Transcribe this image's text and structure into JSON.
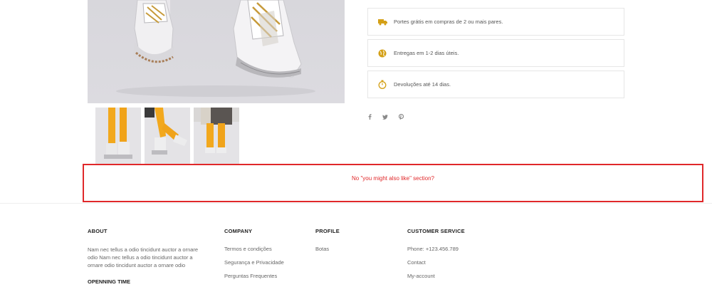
{
  "features": [
    {
      "icon": "truck-icon",
      "text": "Portes grátis em compras de 2 ou mais pares."
    },
    {
      "icon": "globe-icon",
      "text": "Entregas em 1-2 dias úteis."
    },
    {
      "icon": "stopwatch-icon",
      "text": "Devoluções até 14 dias."
    }
  ],
  "social": [
    "facebook-icon",
    "twitter-icon",
    "pinterest-icon"
  ],
  "annotation": {
    "text": "No \"you might also like\" section?",
    "color": "#e0282a"
  },
  "footer": {
    "about": {
      "heading": "ABOUT",
      "text": "Nam nec tellus a odio tincidunt auctor a ornare odio Nam nec tellus a odio tincidunt auctor a ornare odio tincidunt auctor a ornare odio"
    },
    "opening_heading": "OPENNING TIME",
    "company": {
      "heading": "COMPANY",
      "links": [
        "Termos e condições",
        "Segurança e Privacidade",
        "Perguntas Frequentes"
      ]
    },
    "profile": {
      "heading": "PROFILE",
      "links": [
        "Botas"
      ]
    },
    "service": {
      "heading": "CUSTOMER SERVICE",
      "links": [
        "Phone: +123.456.789",
        "Contact",
        "My-account"
      ]
    }
  },
  "colors": {
    "accent": "#d4a017",
    "border": "#e6e6e6"
  }
}
